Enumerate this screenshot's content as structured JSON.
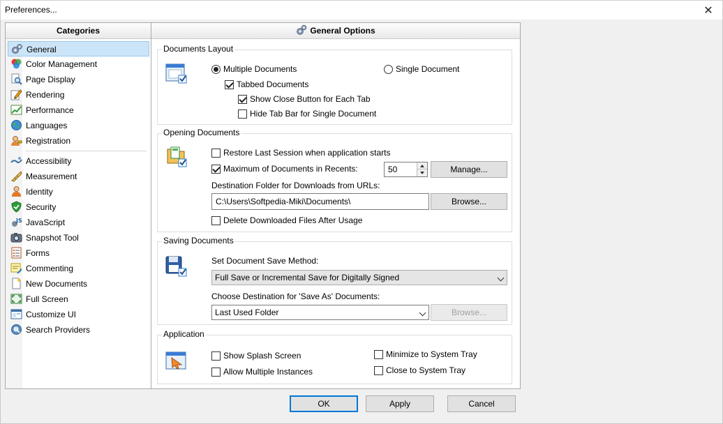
{
  "window": {
    "title": "Preferences...",
    "close_glyph": "✕"
  },
  "categories": {
    "header": "Categories",
    "group1": [
      {
        "label": "General",
        "icon": "general-gears-icon",
        "selected": true
      },
      {
        "label": "Color Management",
        "icon": "color-management-icon"
      },
      {
        "label": "Page Display",
        "icon": "page-display-icon"
      },
      {
        "label": "Rendering",
        "icon": "rendering-icon"
      },
      {
        "label": "Performance",
        "icon": "performance-icon"
      },
      {
        "label": "Languages",
        "icon": "globe-icon"
      },
      {
        "label": "Registration",
        "icon": "registration-key-icon"
      }
    ],
    "group2": [
      {
        "label": "Accessibility",
        "icon": "accessibility-icon"
      },
      {
        "label": "Measurement",
        "icon": "ruler-icon"
      },
      {
        "label": "Identity",
        "icon": "person-icon"
      },
      {
        "label": "Security",
        "icon": "shield-icon"
      },
      {
        "label": "JavaScript",
        "icon": "javascript-icon"
      },
      {
        "label": "Snapshot Tool",
        "icon": "camera-icon"
      },
      {
        "label": "Forms",
        "icon": "forms-icon"
      },
      {
        "label": "Commenting",
        "icon": "comment-icon"
      },
      {
        "label": "New Documents",
        "icon": "new-document-icon"
      },
      {
        "label": "Full Screen",
        "icon": "full-screen-icon"
      },
      {
        "label": "Customize UI",
        "icon": "customize-ui-icon"
      },
      {
        "label": "Search Providers",
        "icon": "search-globe-icon"
      }
    ]
  },
  "options": {
    "header": "General Options",
    "documents_layout": {
      "title": "Documents Layout",
      "multiple": {
        "label": "Multiple Documents",
        "checked": true
      },
      "single": {
        "label": "Single Document",
        "checked": false
      },
      "tabbed": {
        "label": "Tabbed Documents",
        "checked": true
      },
      "show_close": {
        "label": "Show Close Button for Each Tab",
        "checked": true
      },
      "hide_tabbar": {
        "label": "Hide Tab Bar for Single Document",
        "checked": false
      }
    },
    "opening": {
      "title": "Opening Documents",
      "restore": {
        "label": "Restore Last Session when application starts",
        "checked": false
      },
      "max_recent": {
        "label": "Maximum of Documents in Recents:",
        "checked": true,
        "value": "50"
      },
      "manage_button": "Manage...",
      "dest_label": "Destination Folder for Downloads from URLs:",
      "dest_value": "C:\\Users\\Softpedia-Miki\\Documents\\",
      "browse_button": "Browse...",
      "delete_downloaded": {
        "label": "Delete Downloaded Files After Usage",
        "checked": false
      }
    },
    "saving": {
      "title": "Saving Documents",
      "method_label": "Set Document Save Method:",
      "method_value": "Full Save or Incremental Save for Digitally Signed",
      "dest_label": "Choose Destination for 'Save As' Documents:",
      "dest_value": "Last Used Folder",
      "browse_button": "Browse..."
    },
    "application": {
      "title": "Application",
      "splash": {
        "label": "Show Splash Screen",
        "checked": false
      },
      "multi_instances": {
        "label": "Allow Multiple Instances",
        "checked": false
      },
      "min_tray": {
        "label": "Minimize to System Tray",
        "checked": false
      },
      "close_tray": {
        "label": "Close to System Tray",
        "checked": false
      }
    }
  },
  "footer": {
    "ok": "OK",
    "apply": "Apply",
    "cancel": "Cancel"
  }
}
